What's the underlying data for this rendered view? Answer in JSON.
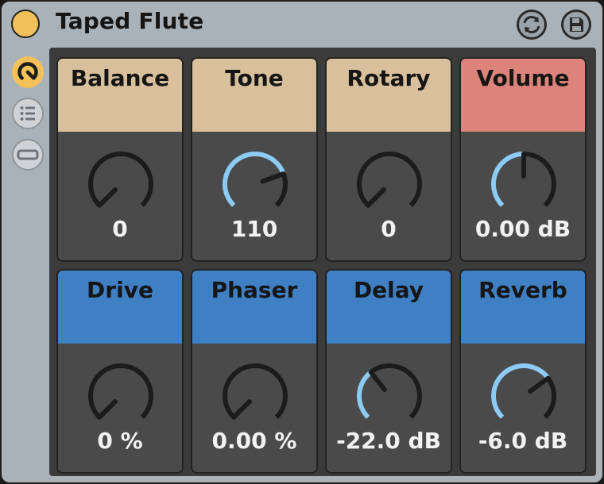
{
  "device": {
    "title": "Taped Flute",
    "power_color": "#f2c15a"
  },
  "header_buttons": [
    {
      "icon": "sync-icon"
    },
    {
      "icon": "save-icon"
    }
  ],
  "sidebar": [
    {
      "icon": "macro-knob-icon",
      "active": true
    },
    {
      "icon": "list-icon",
      "active": false
    },
    {
      "icon": "bar-icon",
      "active": false
    }
  ],
  "colors": {
    "tan": "#d8c09c",
    "salmon": "#dc847a",
    "blue": "#3f7fc4",
    "arc": "#8ccbf4",
    "track": "#1c1c1c"
  },
  "controls": [
    {
      "id": "balance",
      "label": "Balance",
      "value": "0",
      "color": "tan",
      "level": 0.0
    },
    {
      "id": "tone",
      "label": "Tone",
      "value": "110",
      "color": "tan",
      "level": 0.76
    },
    {
      "id": "rotary",
      "label": "Rotary",
      "value": "0",
      "color": "tan",
      "level": 0.0
    },
    {
      "id": "volume",
      "label": "Volume",
      "value": "0.00 dB",
      "color": "salmon",
      "level": 0.5
    },
    {
      "id": "drive",
      "label": "Drive",
      "value": "0 %",
      "color": "blue",
      "level": 0.0
    },
    {
      "id": "phaser",
      "label": "Phaser",
      "value": "0.00 %",
      "color": "blue",
      "level": 0.0
    },
    {
      "id": "delay",
      "label": "Delay",
      "value": "-22.0 dB",
      "color": "blue",
      "level": 0.36
    },
    {
      "id": "reverb",
      "label": "Reverb",
      "value": "-6.0 dB",
      "color": "blue",
      "level": 0.7
    }
  ]
}
